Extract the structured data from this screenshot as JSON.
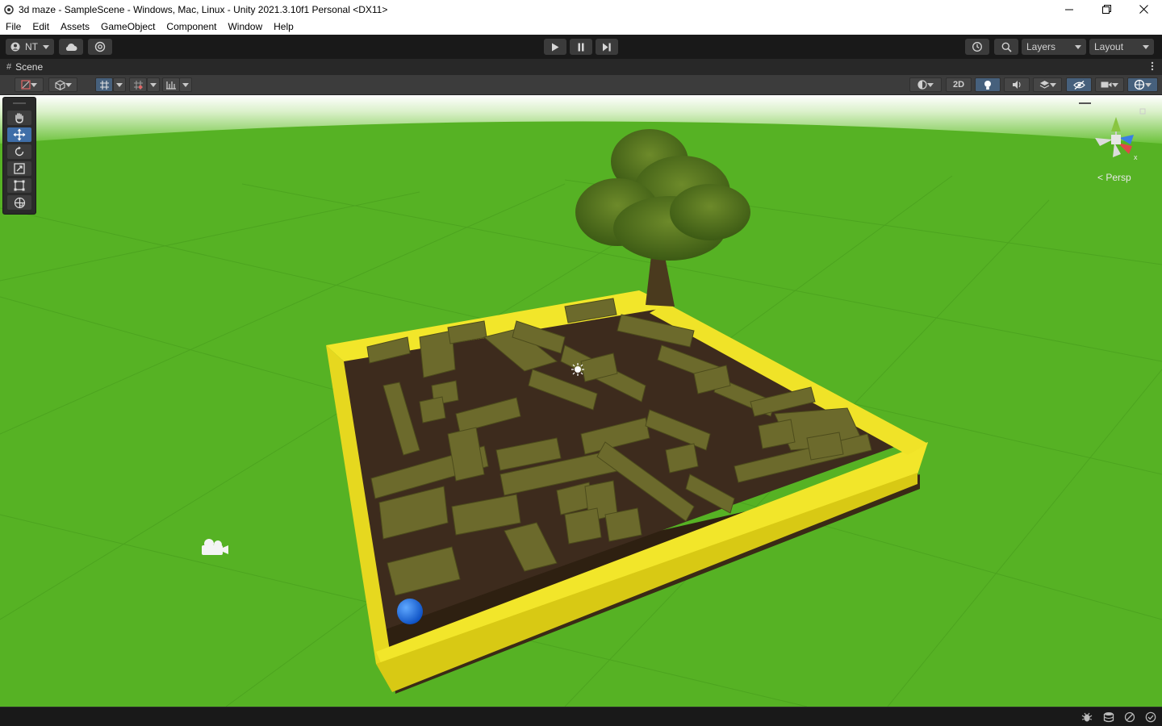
{
  "window": {
    "title": "3d maze - SampleScene - Windows, Mac, Linux - Unity 2021.3.10f1 Personal <DX11>",
    "controls": [
      "minimize-icon",
      "restore-icon",
      "close-icon"
    ]
  },
  "menu": [
    "File",
    "Edit",
    "Assets",
    "GameObject",
    "Component",
    "Window",
    "Help"
  ],
  "toolbar": {
    "account_label": "NT",
    "layers_label": "Layers",
    "layout_label": "Layout",
    "icons": [
      "account-icon",
      "cloud-icon",
      "collab-icon",
      "play-icon",
      "pause-icon",
      "step-icon",
      "history-icon",
      "search-icon"
    ]
  },
  "scene_tab": {
    "label": "Scene",
    "menu_icon": "kebab-icon"
  },
  "scene_toolbar": {
    "two_d_label": "2D",
    "icons": [
      "draw-mode-icon",
      "shading-cube-icon",
      "grid-snap-icon",
      "increment-snap-icon",
      "ruler-icon",
      "render-mode-icon",
      "light-icon",
      "audio-icon",
      "effects-icon",
      "hidden-objects-icon",
      "camera-icon",
      "gizmos-icon"
    ]
  },
  "tools": [
    "hand-tool-icon",
    "move-tool-icon",
    "rotate-tool-icon",
    "scale-tool-icon",
    "rect-tool-icon",
    "transform-tool-icon"
  ],
  "active_tool": "move-tool-icon",
  "gizmo": {
    "projection_label": "Persp",
    "axis_label": "x"
  },
  "colors": {
    "grass": "#56b224",
    "maze_border": "#f2e62a",
    "ball": "#1f6fe8",
    "accent": "#3f6ea8"
  }
}
